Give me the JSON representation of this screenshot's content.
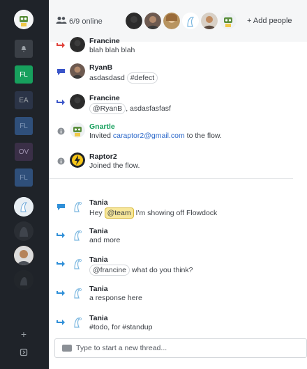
{
  "header": {
    "online": "6/9 online",
    "add_people": "+ Add people"
  },
  "rail": {
    "items": [
      {
        "label": "FL",
        "color": "#17a05d"
      },
      {
        "label": "EA",
        "color": "#2b3447"
      },
      {
        "label": "FL",
        "color": "#2f4f7a"
      },
      {
        "label": "OV",
        "color": "#3a2f47"
      },
      {
        "label": "FL",
        "color": "#2f4f7a"
      }
    ]
  },
  "messages": [
    {
      "author": "Francine",
      "text": "blah blah blah"
    },
    {
      "author": "RyanB",
      "text": "asdasdasd",
      "tag": "#defect"
    },
    {
      "author": "Francine",
      "mention": "@RyanB",
      "text": ", asdasfasfasf"
    },
    {
      "author": "Gnartle",
      "text_before": "Invited ",
      "link": "caraptor2@gmail.com",
      "text_after": " to the flow."
    },
    {
      "author": "Raptor2",
      "text": "Joined the flow."
    },
    {
      "author": "Tania",
      "text_before": "Hey ",
      "mention": "@team",
      "text_after": " I'm showing off Flowdock"
    },
    {
      "author": "Tania",
      "text": "and more"
    },
    {
      "author": "Tania",
      "mention": "@francine",
      "text": " what do you think?"
    },
    {
      "author": "Tania",
      "text": "a response here"
    },
    {
      "author": "Tania",
      "text": "#todo, for #standup"
    }
  ],
  "composer": {
    "placeholder": "Type to start a new thread..."
  },
  "colors": {
    "rail": "#1f2329",
    "reply_arrow": "#2f8fd8",
    "first_arrow": "#e0413a",
    "thread_icon": "#3a55c9",
    "gnartle": "#17a05d"
  },
  "icons": [
    "bell-icon",
    "people-icon",
    "reply-arrow-icon",
    "thread-chat-icon",
    "info-icon",
    "plus-icon",
    "expand-icon",
    "composer-chat-icon"
  ]
}
